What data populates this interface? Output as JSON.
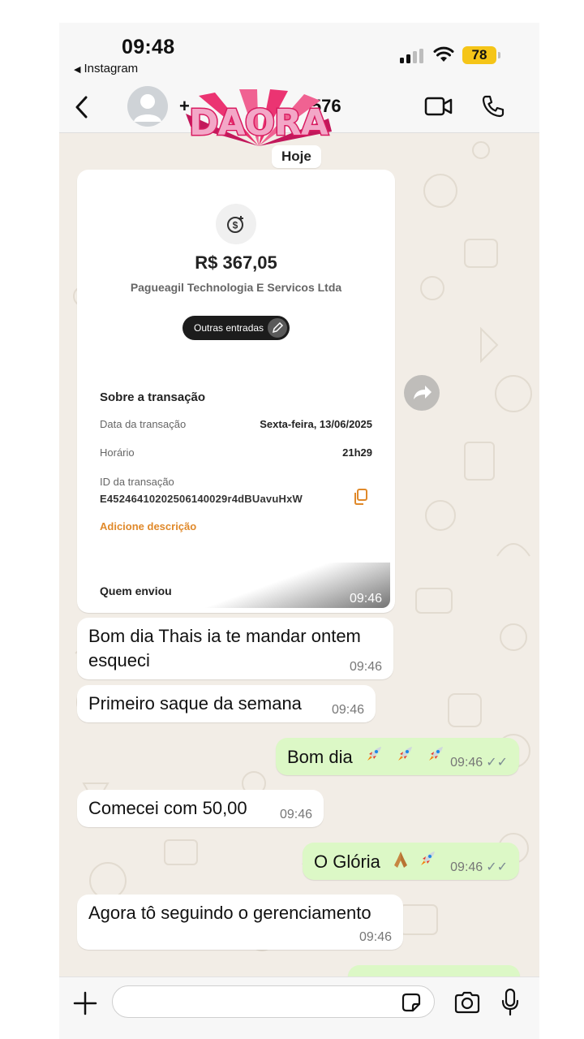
{
  "status_bar": {
    "time": "09:48",
    "back_app": "Instagram",
    "battery": "78"
  },
  "header": {
    "contact_prefix": "+",
    "contact_suffix": "576",
    "overlay_logo_text": "DAORA"
  },
  "chat": {
    "date_chip": "Hoje",
    "receipt": {
      "amount": "R$ 367,05",
      "company": "Pagueagil Technologia E Servicos Ltda",
      "category_pill": "Outras entradas",
      "section_title": "Sobre a transação",
      "date_label": "Data da transação",
      "date_value": "Sexta-feira, 13/06/2025",
      "time_label": "Horário",
      "time_value": "21h29",
      "id_label": "ID da transação",
      "id_value": "E45246410202506140029r4dBUavuHxW",
      "add_description": "Adicione descrição",
      "sender_label": "Quem enviou",
      "sent_time": "09:46"
    },
    "messages": [
      {
        "direction": "in",
        "text": "Bom dia Thais ia te mandar ontem esqueci",
        "time": "09:46"
      },
      {
        "direction": "in",
        "text": "Primeiro saque da semana",
        "time": "09:46"
      },
      {
        "direction": "out",
        "text": "Bom dia",
        "emoji": [
          "rocket",
          "rocket",
          "rocket"
        ],
        "time": "09:46",
        "status": "read"
      },
      {
        "direction": "in",
        "text": "Comecei com 50,00",
        "time": "09:46"
      },
      {
        "direction": "out",
        "text": "O Glória",
        "emoji": [
          "praying-hands",
          "rocket"
        ],
        "time": "09:46",
        "status": "read"
      },
      {
        "direction": "in",
        "text": "Agora tô seguindo o gerenciamento",
        "time": "09:46"
      }
    ]
  },
  "composer": {
    "placeholder": ""
  },
  "colors": {
    "chat_bg": "#f2ede6",
    "outgoing_bubble": "#dcf8c6",
    "incoming_bubble": "#ffffff",
    "battery": "#f5c518",
    "link_orange": "#e0892a"
  }
}
